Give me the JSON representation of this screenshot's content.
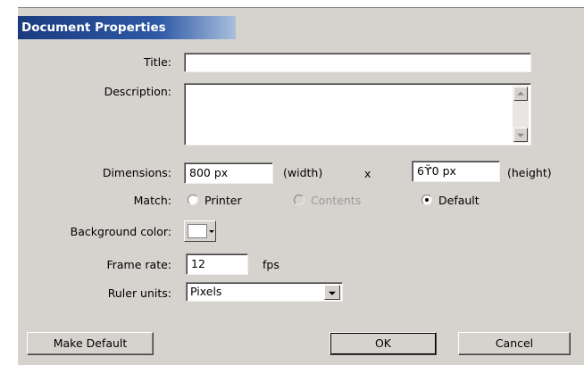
{
  "dialog": {
    "title": "Document Properties"
  },
  "fields": {
    "title_label": "Title:",
    "title_value": "",
    "description_label": "Description:",
    "description_value": "",
    "dimensions_label": "Dimensions:",
    "width_value": "800 px",
    "width_suffix": "(width)",
    "times": "x",
    "height_value": "6ϔ0 px",
    "height_suffix": "(height)",
    "match_label": "Match:",
    "match_options": [
      {
        "label": "Printer",
        "selected": false,
        "enabled": true
      },
      {
        "label": "Contents",
        "selected": false,
        "enabled": false
      },
      {
        "label": "Default",
        "selected": true,
        "enabled": true
      }
    ],
    "bgcolor_label": "Background color:",
    "bgcolor_value": "#FFFFFF",
    "framerate_label": "Frame rate:",
    "framerate_value": "12",
    "framerate_unit": "fps",
    "ruler_label": "Ruler units:",
    "ruler_value": "Pixels"
  },
  "buttons": {
    "make_default": "Make Default",
    "ok": "OK",
    "cancel": "Cancel"
  },
  "icons": {
    "scroll_up": "scroll-up-arrow-icon",
    "scroll_down": "scroll-down-arrow-icon",
    "dropdown": "chevron-down-icon"
  }
}
